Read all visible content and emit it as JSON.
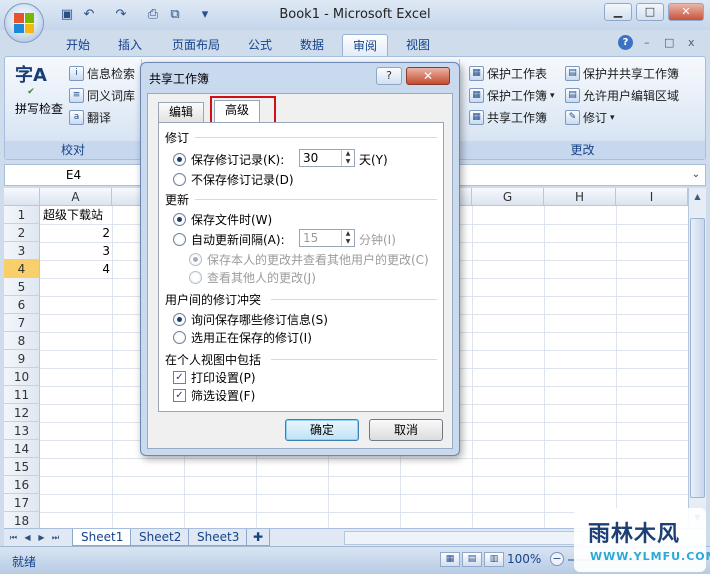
{
  "window": {
    "title": "Book1 - Microsoft Excel",
    "minimize": "▁",
    "maximize": "□",
    "close": "✕",
    "mini_controls": [
      "–",
      "□",
      "x"
    ]
  },
  "quick_access": [
    "save-icon",
    "undo-icon",
    "redo-icon",
    "print-preview-icon",
    "dropdown-icon"
  ],
  "ribbon_tabs": [
    "开始",
    "插入",
    "页面布局",
    "公式",
    "数据",
    "审阅",
    "视图"
  ],
  "active_tab": "审阅",
  "ribbon": {
    "spelling_big": "字A",
    "spelling_label": "拼写检查",
    "proofing_items": [
      "信息检索",
      "同义词库",
      "翻译"
    ],
    "proofing_group_label": "校对",
    "changes_items": [
      "保护工作表",
      "保护并共享工作簿",
      "保护工作簿",
      "允许用户编辑区域",
      "共享工作簿",
      "修订"
    ],
    "changes_group_label": "更改"
  },
  "formula_bar": {
    "name_box": "E4"
  },
  "grid": {
    "columns": [
      "A",
      "",
      "",
      "",
      "",
      "",
      "G",
      "H",
      "I"
    ],
    "rows": [
      "1",
      "2",
      "3",
      "4",
      "5",
      "6",
      "7",
      "8",
      "9",
      "10",
      "11",
      "12",
      "13",
      "14",
      "15",
      "16",
      "17",
      "18"
    ],
    "active_row": "4",
    "cells": {
      "A1": "超级下载站",
      "A2": "2",
      "A3": "3",
      "A4": "4"
    }
  },
  "sheets": [
    "Sheet1",
    "Sheet2",
    "Sheet3"
  ],
  "active_sheet": "Sheet1",
  "status": {
    "text": "就绪",
    "zoom": "100%"
  },
  "watermark": {
    "title": "雨林木风",
    "url": "WWW.YLMFU.COM"
  },
  "dialog": {
    "title": "共享工作簿",
    "help": "?",
    "close": "✕",
    "tabs": [
      "编辑",
      "高级"
    ],
    "active_tab": "高级",
    "sections": {
      "track_changes": "修订",
      "update": "更新",
      "conflicts": "用户间的修订冲突",
      "personal_view": "在个人视图中包括"
    },
    "options": {
      "keep_history": "保存修订记录(K):",
      "keep_history_days": "30",
      "days_unit": "天(Y)",
      "dont_keep_history": "不保存修订记录(D)",
      "when_saved": "保存文件时(W)",
      "auto_every": "自动更新间隔(A):",
      "auto_minutes": "15",
      "minutes_unit": "分钟(I)",
      "save_my_changes": "保存本人的更改并查看其他用户的更改(C)",
      "just_see": "查看其他人的更改(J)",
      "ask_me": "询问保存哪些修订信息(S)",
      "saved_win": "选用正在保存的修订(I)",
      "print_settings": "打印设置(P)",
      "filter_settings": "筛选设置(F)"
    },
    "ok": "确定",
    "cancel": "取消"
  }
}
